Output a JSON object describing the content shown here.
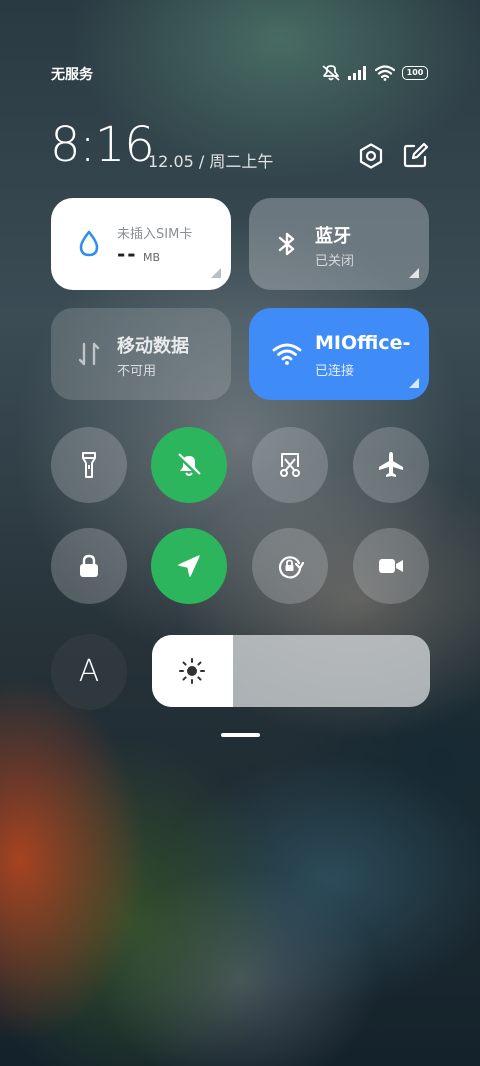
{
  "status_bar": {
    "carrier": "无服务",
    "battery_level": "100",
    "icons": [
      "mute-icon",
      "signal-icon",
      "wifi-icon",
      "battery-icon"
    ]
  },
  "header": {
    "time": "8:16",
    "date": "12.05 / 周二上午",
    "icons": [
      "settings-icon",
      "edit-icon"
    ]
  },
  "tiles": {
    "data_usage": {
      "label": "未插入SIM卡",
      "value": "--",
      "unit": "MB",
      "icon": "water-drop-icon"
    },
    "bluetooth": {
      "label": "蓝牙",
      "status": "已关闭",
      "icon": "bluetooth-icon"
    },
    "mobile_data": {
      "label": "移动数据",
      "status": "不可用",
      "icon": "mobile-data-icon"
    },
    "wifi": {
      "label": "MIOffice-",
      "status": "已连接",
      "icon": "wifi-icon"
    }
  },
  "toggles": [
    {
      "name": "flashlight",
      "icon": "flashlight-icon",
      "on": false
    },
    {
      "name": "silent",
      "icon": "bell-off-icon",
      "on": true
    },
    {
      "name": "screenshot",
      "icon": "scissors-icon",
      "on": false
    },
    {
      "name": "airplane",
      "icon": "airplane-icon",
      "on": false
    },
    {
      "name": "lock-screen",
      "icon": "lock-icon",
      "on": false
    },
    {
      "name": "location",
      "icon": "location-arrow-icon",
      "on": true
    },
    {
      "name": "rotation-lock",
      "icon": "rotation-lock-icon",
      "on": false
    },
    {
      "name": "screen-record",
      "icon": "video-camera-icon",
      "on": false
    }
  ],
  "font_button": {
    "label": "A"
  },
  "brightness": {
    "level": 0.29,
    "icon": "sun-icon"
  },
  "colors": {
    "wifi_active": "#3f8cf9",
    "toggle_active": "#2db55d",
    "data_tile_bg": "#ffffff"
  }
}
